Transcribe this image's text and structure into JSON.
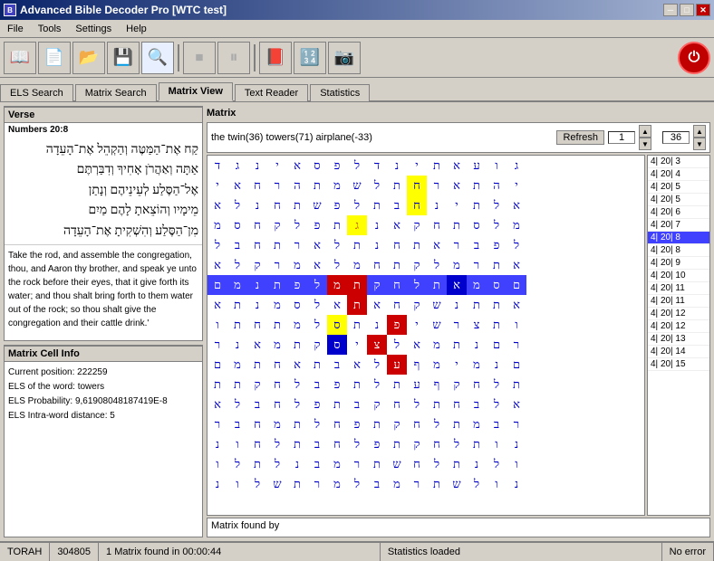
{
  "window": {
    "title": "Advanced Bible Decoder Pro [WTC test]",
    "icon": "📖"
  },
  "menu": {
    "items": [
      "File",
      "Tools",
      "Settings",
      "Help"
    ]
  },
  "toolbar": {
    "buttons": [
      {
        "name": "open-bible",
        "icon": "📖"
      },
      {
        "name": "new",
        "icon": "📄"
      },
      {
        "name": "open",
        "icon": "📂"
      },
      {
        "name": "save",
        "icon": "💾"
      },
      {
        "name": "search",
        "icon": "🔍"
      },
      {
        "name": "stop",
        "icon": "⏹"
      },
      {
        "name": "pause",
        "icon": "⏸"
      },
      {
        "name": "book",
        "icon": "📕"
      },
      {
        "name": "calc",
        "icon": "🔢"
      },
      {
        "name": "camera",
        "icon": "📷"
      }
    ],
    "power_label": "⏻"
  },
  "tabs": {
    "items": [
      {
        "label": "ELS Search",
        "active": false
      },
      {
        "label": "Matrix Search",
        "active": false
      },
      {
        "label": "Matrix View",
        "active": true
      },
      {
        "label": "Text Reader",
        "active": false
      },
      {
        "label": "Statistics",
        "active": false
      }
    ]
  },
  "verse": {
    "header": "Verse",
    "reference": "Numbers 20:8",
    "hebrew": "קַח אֶת־הַמַּטֶּה וְהַקְהֵל אֶת־הָעֵדָה\nאַתָּה וְאַהֲרֹן אָחִיךָ וְדִבַּרְתֶּם\nאֶל־הַסֶּלַע לְעֵינֵיהֶם וְנָתַן\nמֵימָיו וְהוֹצֵאתָ לָהֶם מַיִם\nמִן־הַסֶּלַע וְהִשְׁקִיתָ אֶת־הָעֵדָה\nוְאֶת־בְּעִירָם׃",
    "english": "Take the rod, and assemble the congregation, thou, and Aaron thy brother, and speak ye unto the rock before their eyes, that it give forth its water; and thou shalt bring forth to them water out of the rock; so thou shalt give the congregation and their cattle drink.'"
  },
  "matrix_cell_info": {
    "header": "Matrix Cell Info",
    "position_label": "Current position:",
    "position_value": "222259",
    "els_label": "ELS of the word:",
    "els_value": "towers",
    "probability_label": "ELS Probability:",
    "probability_value": "9,61908048187419E-8",
    "distance_label": "ELS Intra-word distance:",
    "distance_value": "5"
  },
  "matrix": {
    "header": "Matrix",
    "search_text": "the twin(36) towers(71) airplane(-33)",
    "refresh_label": "Refresh",
    "num_value": "1",
    "right_num": "36",
    "found_label": "Matrix found by",
    "rows": [
      {
        "cells": [
          "ג",
          "ו",
          "ע",
          "א",
          "ת",
          "י",
          "נ",
          "ד",
          "ל",
          "פ",
          "ס",
          "א",
          "י",
          "נ",
          "ג",
          "ד"
        ],
        "row_info": "4| 20| 3"
      },
      {
        "cells": [
          "י",
          "ה",
          "ת",
          "א",
          "ר",
          "ח",
          "ת",
          "ל",
          "ש",
          "מ",
          "ת",
          "ה",
          "ר",
          "ח",
          "א",
          "י"
        ],
        "row_info": "4| 20| 4",
        "highlight": [
          5
        ]
      },
      {
        "cells": [
          "א",
          "ל",
          "ת",
          "י",
          "נ",
          "ח",
          "ב",
          "ת",
          "ל",
          "פ",
          "ש",
          "ת",
          "ח",
          "נ",
          "ל",
          "א"
        ],
        "row_info": "4| 20| 5",
        "highlight": [
          5
        ]
      },
      {
        "cells": [
          "מ",
          "ל",
          "ס",
          "ת",
          "ח",
          "ק",
          "א",
          "נ",
          "ג",
          "ת",
          "פ",
          "ל",
          "ק",
          "ח",
          "ס",
          "מ"
        ],
        "row_info": "4| 20| 5",
        "highlight": [
          5
        ],
        "yellow": [
          8
        ]
      },
      {
        "cells": [
          "ל",
          "פ",
          "ב",
          "ר",
          "א",
          "ת",
          "ח",
          "נ",
          "ת",
          "ל",
          "א",
          "ר",
          "ת",
          "ח",
          "ב",
          "ל"
        ],
        "row_info": "4| 20| 6"
      },
      {
        "cells": [
          "א",
          "ת",
          "ר",
          "מ",
          "ל",
          "ק",
          "ת",
          "ח",
          "מ",
          "ל",
          "א",
          "מ",
          "ר",
          "ק",
          "ל",
          "א"
        ],
        "row_info": "4| 20| 7"
      },
      {
        "cells": [
          "ם",
          "ס",
          "מ",
          "א",
          "ת",
          "ל",
          "ח",
          "ק",
          "ת",
          "מ",
          "ל",
          "פ",
          "ת",
          "נ",
          "מ",
          "ם"
        ],
        "row_info": "4| 20| 8",
        "active_row": true,
        "red": [
          8,
          9
        ],
        "blue": [
          3
        ]
      },
      {
        "cells": [
          "א",
          "ת",
          "ת",
          "נ",
          "ש",
          "ק",
          "ח",
          "א",
          "ת",
          "א",
          "ל",
          "ס",
          "מ",
          "נ",
          "ת",
          "א"
        ],
        "row_info": "4| 20| 8",
        "red": [
          8
        ]
      },
      {
        "cells": [
          "ו",
          "ת",
          "צ",
          "ר",
          "ש",
          "י",
          "פ",
          "נ",
          "ת",
          "ס",
          "ל",
          "מ",
          "ת",
          "ח",
          "ת",
          "ו"
        ],
        "row_info": "4| 20| 9",
        "red": [
          6
        ],
        "yellow_cell": [
          9
        ]
      },
      {
        "cells": [
          "ר",
          "ם",
          "נ",
          "ת",
          "מ",
          "א",
          "ל",
          "צ",
          "י",
          "ס",
          "ק",
          "ת",
          "מ",
          "א",
          "נ",
          "ר"
        ],
        "row_info": "4| 20| 10",
        "red": [
          7
        ],
        "blue": [
          9
        ]
      },
      {
        "cells": [
          "ם",
          "נ",
          "מ",
          "י",
          "מ",
          "ף",
          "ע",
          "ל",
          "א",
          "ב",
          "ת",
          "א",
          "ח",
          "ת",
          "מ",
          "ם"
        ],
        "row_info": "4| 20| 11",
        "red": [
          6
        ]
      },
      {
        "cells": [
          "ת",
          "ל",
          "ח",
          "ק",
          "ף",
          "ע",
          "ת",
          "ל",
          "ת",
          "פ",
          "ב",
          "ל",
          "ח",
          "ק",
          "ת",
          "ת"
        ],
        "row_info": "4| 20| 11"
      },
      {
        "cells": [
          "א",
          "ל",
          "ב",
          "ח",
          "ת",
          "ל",
          "ח",
          "ק",
          "ב",
          "ת",
          "פ",
          "ל",
          "ח",
          "ב",
          "ל",
          "א"
        ],
        "row_info": "4| 20| 12"
      },
      {
        "cells": [
          "ר",
          "ב",
          "מ",
          "ת",
          "ל",
          "ח",
          "ק",
          "ת",
          "פ",
          "ח",
          "ל",
          "ת",
          "מ",
          "ח",
          "ב",
          "ר"
        ],
        "row_info": "4| 20| 12"
      },
      {
        "cells": [
          "נ",
          "ו",
          "ת",
          "ל",
          "ח",
          "ק",
          "ת",
          "פ",
          "ל",
          "ח",
          "ב",
          "ת",
          "ל",
          "ח",
          "ו",
          "נ"
        ],
        "row_info": "4| 20| 13"
      },
      {
        "cells": [
          "ו",
          "ל",
          "נ",
          "ת",
          "ל",
          "ח",
          "ש",
          "ת",
          "ר",
          "מ",
          "ב",
          "נ",
          "ל",
          "ת",
          "ל",
          "ו"
        ],
        "row_info": "4| 20| 14"
      },
      {
        "cells": [
          "נ",
          "ו",
          "ל",
          "ש",
          "ת",
          "ר",
          "מ",
          "ב",
          "ל",
          "מ",
          "ר",
          "ת",
          "ש",
          "ל",
          "ו",
          "נ"
        ],
        "row_info": "4| 20| 15"
      }
    ]
  },
  "status": {
    "torah": "TORAH",
    "count": "304805",
    "matrix_found": "1 Matrix found in 00:00:44",
    "statistics": "Statistics loaded",
    "error": "No error"
  }
}
